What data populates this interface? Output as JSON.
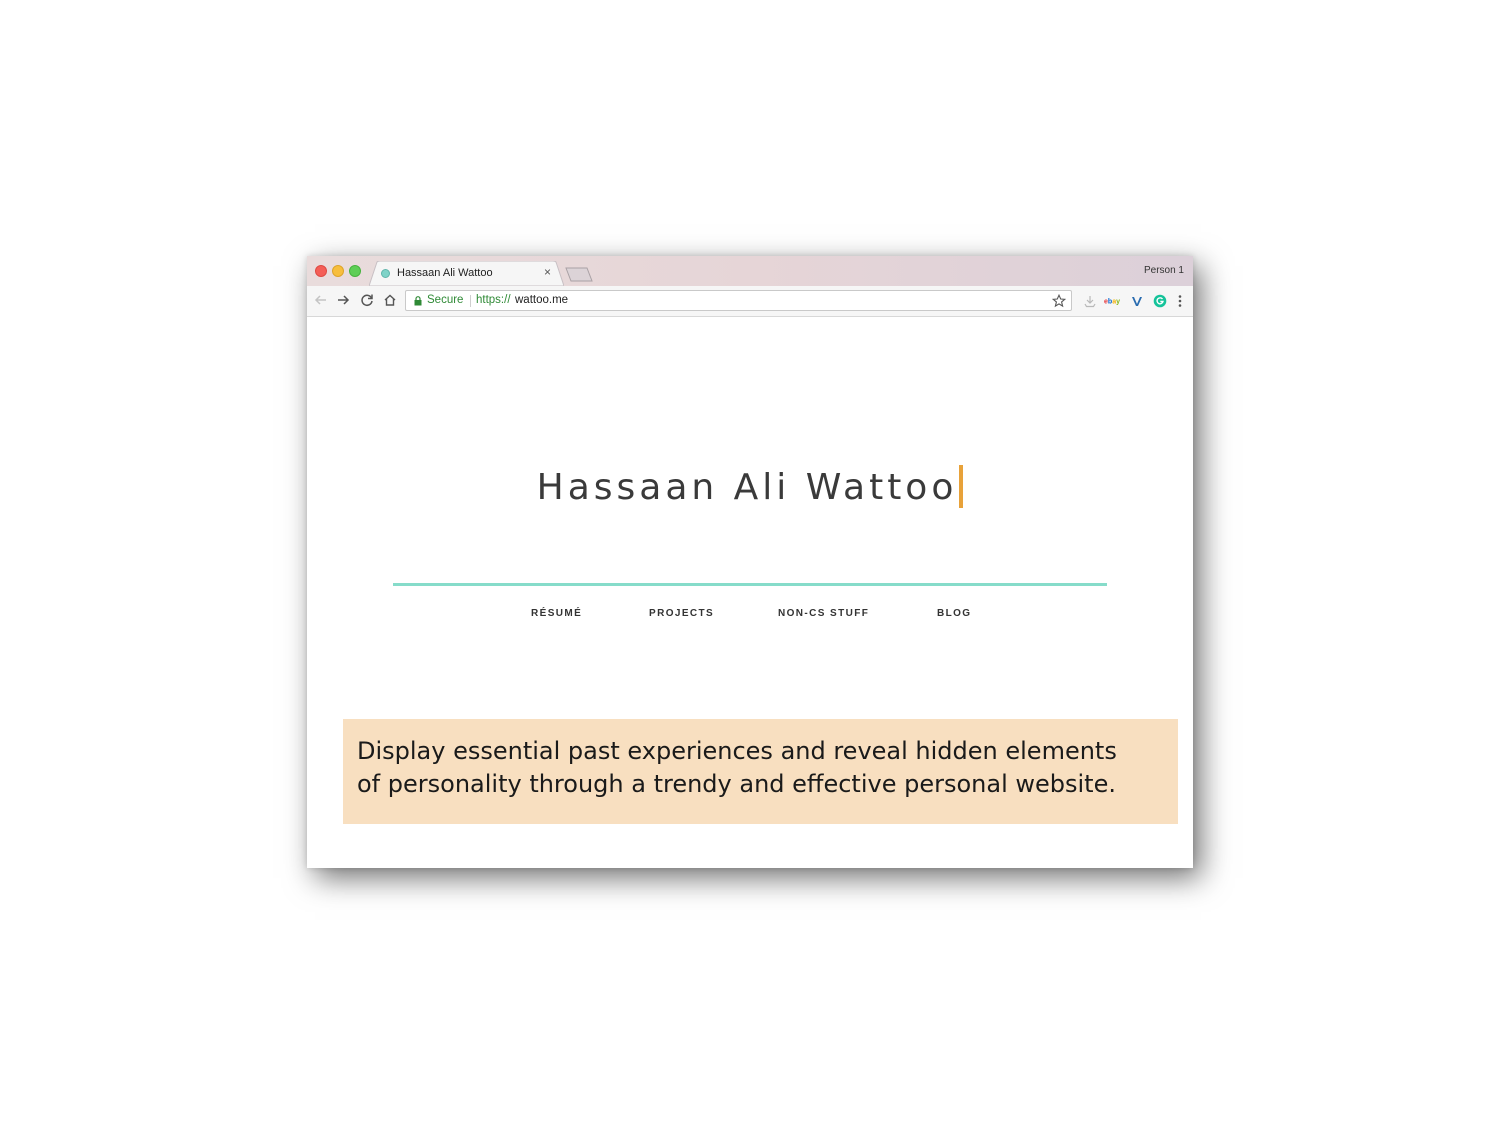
{
  "browser": {
    "tab": {
      "title": "Hassaan Ali Wattoo",
      "close_glyph": "×"
    },
    "profile_label": "Person 1",
    "toolbar": {
      "back_icon": "back-arrow-icon",
      "forward_icon": "forward-arrow-icon",
      "reload_icon": "reload-icon",
      "home_icon": "home-icon"
    },
    "omnibox": {
      "secure_label": "Secure",
      "url_scheme": "https://",
      "url_host": "wattoo.me"
    },
    "extensions": [
      "download-icon",
      "ebay-icon",
      "vimeo-icon",
      "grammarly-icon",
      "menu-dots-icon"
    ],
    "extension_labels": {
      "ebay": "ebay",
      "grammarly": "G"
    }
  },
  "page": {
    "hero_title": "Hassaan Ali Wattoo",
    "nav": [
      {
        "label": "RÉSUMÉ"
      },
      {
        "label": "PROJECTS"
      },
      {
        "label": "NON-CS STUFF"
      },
      {
        "label": "BLOG"
      }
    ],
    "accent_color": "#86dcca",
    "cursor_color": "#e8a23a"
  },
  "callout": {
    "line1": "Display essential past experiences and reveal hidden elements",
    "line2": "of personality through a trendy and effective personal website.",
    "background": "#f8dfc0"
  }
}
